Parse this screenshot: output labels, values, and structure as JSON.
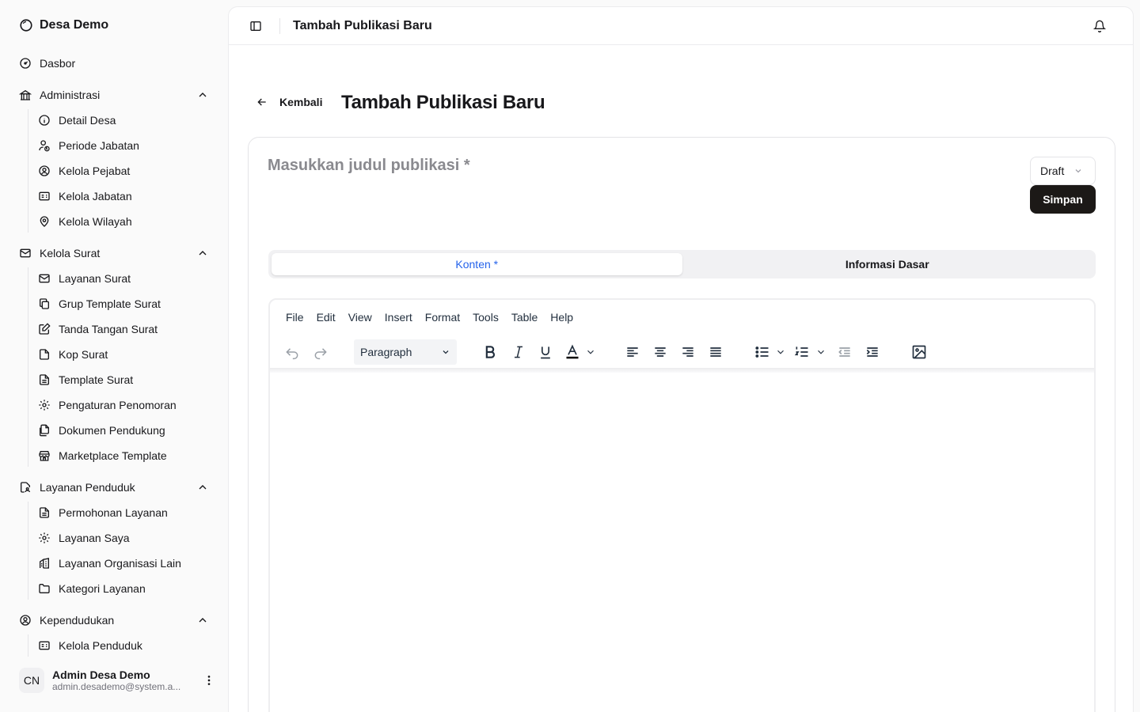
{
  "app": {
    "name": "Desa Demo"
  },
  "sidebar": {
    "dashboard": "Dasbor",
    "groups": [
      {
        "label": "Administrasi",
        "items": [
          "Detail Desa",
          "Periode Jabatan",
          "Kelola Pejabat",
          "Kelola Jabatan",
          "Kelola Wilayah"
        ]
      },
      {
        "label": "Kelola Surat",
        "items": [
          "Layanan Surat",
          "Grup Template Surat",
          "Tanda Tangan Surat",
          "Kop Surat",
          "Template Surat",
          "Pengaturan Penomoran",
          "Dokumen Pendukung",
          "Marketplace Template"
        ]
      },
      {
        "label": "Layanan Penduduk",
        "items": [
          "Permohonan Layanan",
          "Layanan Saya",
          "Layanan Organisasi Lain",
          "Kategori Layanan"
        ]
      },
      {
        "label": "Kependudukan",
        "items": [
          "Kelola Penduduk"
        ]
      }
    ],
    "user": {
      "initials": "CN",
      "name": "Admin Desa Demo",
      "email": "admin.desademo@system.a..."
    }
  },
  "header": {
    "title": "Tambah Publikasi Baru"
  },
  "page": {
    "back_label": "Kembali",
    "title": "Tambah Publikasi Baru",
    "title_placeholder": "Masukkan judul publikasi *",
    "status": "Draft",
    "save_label": "Simpan",
    "tabs": [
      {
        "label": "Konten *",
        "active": true
      },
      {
        "label": "Informasi Dasar",
        "active": false
      }
    ]
  },
  "editor": {
    "menu": [
      "File",
      "Edit",
      "View",
      "Insert",
      "Format",
      "Tools",
      "Table",
      "Help"
    ],
    "block_format": "Paragraph"
  },
  "colors": {
    "accent": "#2563eb",
    "primary_button": "#1c1917",
    "background": "#fafafa"
  }
}
